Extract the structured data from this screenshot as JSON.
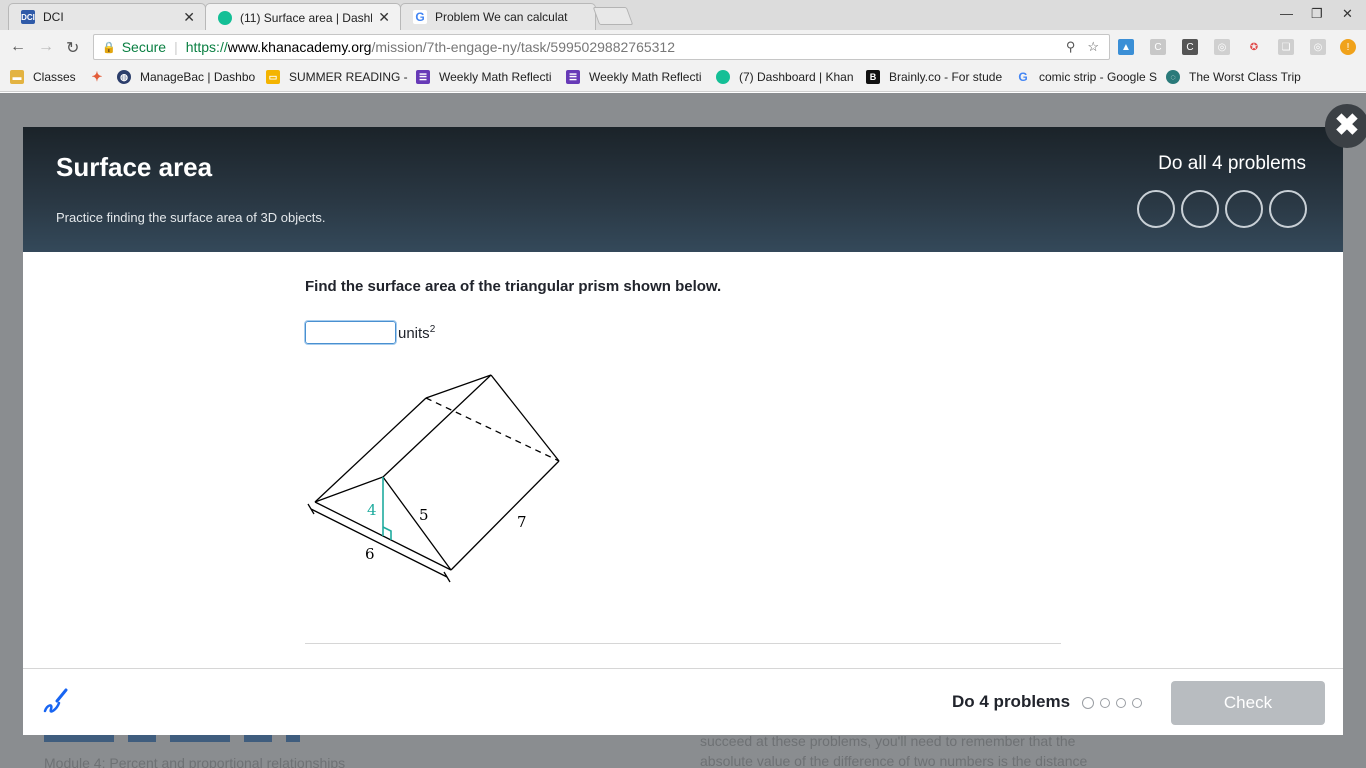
{
  "browser": {
    "tabs": [
      {
        "title": "DCI",
        "active": false
      },
      {
        "title": "(11) Surface area | Dashb",
        "active": true
      },
      {
        "title": "Problem We can calculat",
        "active": false
      }
    ],
    "address": {
      "secure_label": "Secure",
      "url_scheme": "https://",
      "url_host": "www.khanacademy.org",
      "url_path": "/mission/7th-engage-ny/task/5995029882765312"
    },
    "bookmarks": [
      {
        "label": "Classes",
        "icon": "folder-icon"
      },
      {
        "label": "ManageBac | Dashbo",
        "icon": "managebac-icon"
      },
      {
        "label": "SUMMER READING -",
        "icon": "slides-icon"
      },
      {
        "label": "Weekly Math Reflecti",
        "icon": "form-icon"
      },
      {
        "label": "Weekly Math Reflecti",
        "icon": "form-icon"
      },
      {
        "label": "(7) Dashboard | Khan",
        "icon": "khan-icon"
      },
      {
        "label": "Brainly.co - For stude",
        "icon": "brainly-icon"
      },
      {
        "label": "comic strip - Google S",
        "icon": "google-icon"
      },
      {
        "label": "The Worst Class Trip",
        "icon": "circle-icon"
      }
    ]
  },
  "background": {
    "text_right_1": "succeed at these problems, you'll need to remember that the",
    "text_right_2": "absolute value of the difference of two numbers is the distance",
    "text_left": "Module 4: Percent and proportional relationships"
  },
  "modal": {
    "title": "Surface area",
    "subtitle": "Practice finding the surface area of 3D objects.",
    "progress_label": "Do all 4 problems",
    "problem_count": 4,
    "question": "Find the surface area of the triangular prism shown below.",
    "answer": {
      "value": "",
      "units": "units",
      "units_exp": "2"
    },
    "figure": {
      "height_label": "4",
      "slant_label": "5",
      "length_label": "7",
      "base_label": "6"
    },
    "footer": {
      "do_label": "Do 4 problems",
      "check_label": "Check"
    }
  },
  "colors": {
    "accent_teal": "#1fab9e",
    "check_disabled": "#b8bcc0",
    "header_dark": "#1b2329"
  }
}
